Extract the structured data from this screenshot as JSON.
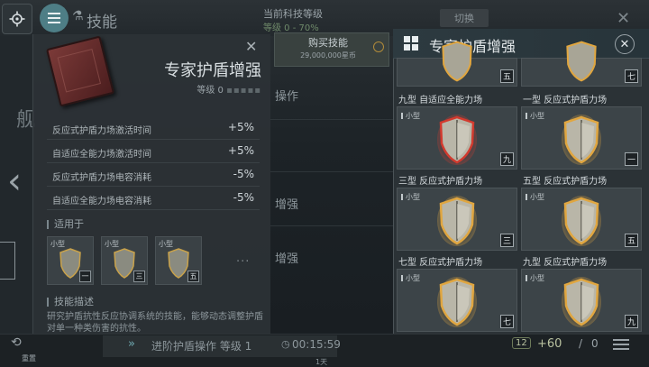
{
  "header": {
    "title": "技能",
    "tech_level_label": "当前科技等级",
    "tech_level_sub": "等级 0 - 70%",
    "switch_label": "切换"
  },
  "background": {
    "item_operation": "操作",
    "item_enhance1": "增强",
    "item_enhance2": "增强",
    "side_char": "舰"
  },
  "detail": {
    "title": "专家护盾增强",
    "level": "等级 0",
    "stats": [
      {
        "name": "反应式护盾力场激活时间",
        "value": "+5%"
      },
      {
        "name": "自适应全能力场激活时间",
        "value": "+5%"
      },
      {
        "name": "反应式护盾力场电容消耗",
        "value": "-5%"
      },
      {
        "name": "自适应全能力场电容消耗",
        "value": "-5%"
      }
    ],
    "applies_to_label": "适用于",
    "mini_items": [
      {
        "tag": "小型",
        "num": "一"
      },
      {
        "tag": "小型",
        "num": "三"
      },
      {
        "tag": "小型",
        "num": "五"
      }
    ],
    "more": "···",
    "desc_label": "技能描述",
    "desc_text": "研究护盾抗性反应协调系统的技能，能够动态调整护盾对单一种类伤害的抗性。"
  },
  "buy": {
    "label": "购买技能",
    "price": "29,000,000星币"
  },
  "picker": {
    "title": "专家护盾增强",
    "top_nums": [
      "五",
      "七"
    ],
    "cards": [
      {
        "name": "九型 自适应全能力场",
        "size": "小型",
        "num": "九",
        "tint": "#d23a2e"
      },
      {
        "name": "一型 反应式护盾力场",
        "size": "小型",
        "num": "一",
        "tint": "#e0a640"
      },
      {
        "name": "三型 反应式护盾力场",
        "size": "小型",
        "num": "三",
        "tint": "#e0a640"
      },
      {
        "name": "五型 反应式护盾力场",
        "size": "小型",
        "num": "五",
        "tint": "#e0a640"
      },
      {
        "name": "七型 反应式护盾力场",
        "size": "小型",
        "num": "七",
        "tint": "#e0a640"
      },
      {
        "name": "九型 反应式护盾力场",
        "size": "小型",
        "num": "九",
        "tint": "#e0a640"
      }
    ]
  },
  "bottom": {
    "task": "进阶护盾操作 等级 1",
    "timer": "00:15:59",
    "reset": "重置",
    "day": "1天",
    "count_a": "12",
    "count_b": "+60",
    "count_c": "0"
  }
}
